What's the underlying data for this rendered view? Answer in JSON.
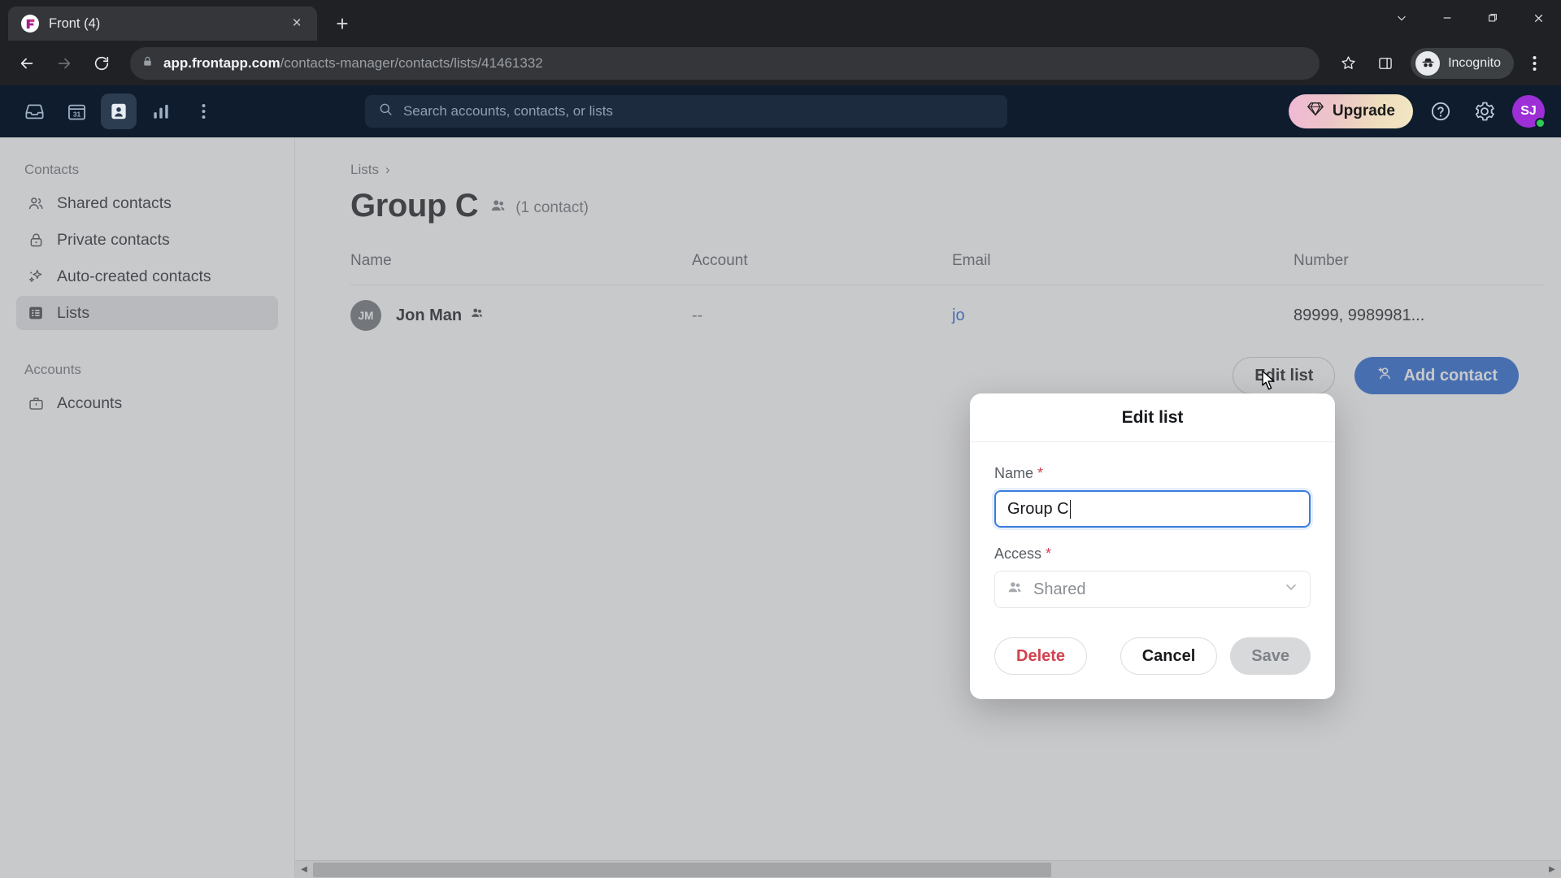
{
  "browser": {
    "tab": {
      "title": "Front (4)",
      "favicon": "front-logo-icon",
      "close": "×"
    },
    "new_tab_label": "+",
    "window_controls": [
      "tab-search-chevron",
      "minimize",
      "maximize",
      "close"
    ],
    "nav": {
      "back": "back-arrow-icon",
      "forward": "forward-arrow-icon",
      "reload": "reload-icon"
    },
    "omnibox": {
      "lock": "lock-icon",
      "url_domain": "app.frontapp.com",
      "url_path": "/contacts-manager/contacts/lists/41461332",
      "bookmark": "star-icon",
      "side_panel": "side-panel-icon",
      "menu": "three-dot-menu-icon"
    },
    "profile": {
      "label": "Incognito",
      "icon": "incognito-hat-icon"
    }
  },
  "appbar": {
    "nav_icons": [
      {
        "name": "inbox-icon",
        "active": false
      },
      {
        "name": "calendar-icon",
        "active": false,
        "label": "31"
      },
      {
        "name": "contacts-icon",
        "active": true
      },
      {
        "name": "analytics-icon",
        "active": false
      },
      {
        "name": "more-icon",
        "active": false
      }
    ],
    "search": {
      "placeholder": "Search accounts, contacts, or lists",
      "icon": "search-icon",
      "value": ""
    },
    "upgrade": {
      "label": "Upgrade",
      "icon": "diamond-icon"
    },
    "help_icon": "help-circle-icon",
    "settings_icon": "gear-icon",
    "avatar": {
      "initials": "SJ",
      "status": "online",
      "color": "#9c2fd6"
    }
  },
  "sidebar": {
    "sections": [
      {
        "heading": "Contacts",
        "items": [
          {
            "label": "Shared contacts",
            "icon": "people-icon",
            "active": false
          },
          {
            "label": "Private contacts",
            "icon": "lock-icon",
            "active": false
          },
          {
            "label": "Auto-created contacts",
            "icon": "sparkles-icon",
            "active": false
          },
          {
            "label": "Lists",
            "icon": "list-grid-icon",
            "active": true
          }
        ]
      },
      {
        "heading": "Accounts",
        "items": [
          {
            "label": "Accounts",
            "icon": "briefcase-icon",
            "active": false
          }
        ]
      }
    ]
  },
  "main": {
    "breadcrumb": {
      "label": "Lists",
      "separator": "›"
    },
    "title": "Group C",
    "title_icon": "shared-people-icon",
    "contact_count": "(1 contact)",
    "actions": {
      "edit_list": "Edit list",
      "add_contact": "Add contact",
      "add_contact_icon": "add-person-icon"
    },
    "table": {
      "columns": [
        "Name",
        "Account",
        "Email",
        "Number"
      ],
      "rows": [
        {
          "initials": "JM",
          "name": "Jon Man",
          "name_icon": "shared-people-icon",
          "account": "--",
          "email": "jo",
          "number": "89999, 9989981..."
        }
      ]
    },
    "scrollbar": {
      "left_arrow": "◀",
      "right_arrow": "▶",
      "thumb_percent": "60"
    }
  },
  "modal": {
    "title": "Edit list",
    "name_label": "Name",
    "name_required": "*",
    "name_value": "Group C",
    "access_label": "Access",
    "access_required": "*",
    "access_value": "Shared",
    "access_icon": "people-icon",
    "access_chevron": "chevron-down-icon",
    "buttons": {
      "delete": "Delete",
      "cancel": "Cancel",
      "save": "Save"
    }
  },
  "colors": {
    "accent_blue": "#2264d1",
    "danger_red": "#d0434f",
    "appbar_dark": "#0e1c2e",
    "focus_blue": "#3b7ddd"
  }
}
